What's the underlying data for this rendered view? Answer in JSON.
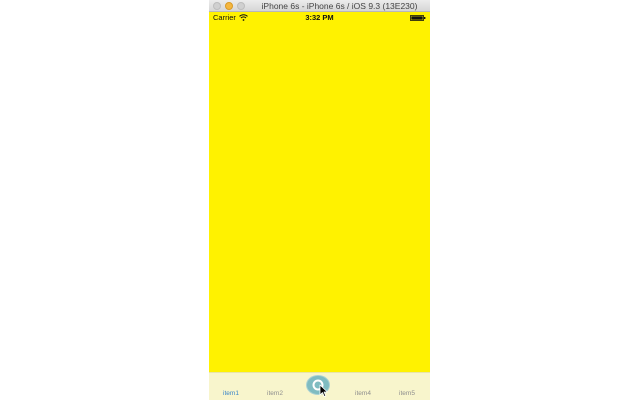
{
  "window": {
    "title": "iPhone 6s - iPhone 6s / iOS 9.3 (13E230)"
  },
  "statusbar": {
    "carrier": "Carrier",
    "time": "3:32 PM"
  },
  "content": {
    "background_color": "#fff200"
  },
  "tabbar": {
    "background_color": "#f8f5cc",
    "selected_color": "#3b86c9",
    "items": [
      {
        "label": "item1",
        "selected": true
      },
      {
        "label": "item2",
        "selected": false
      },
      {
        "label": "",
        "selected": false,
        "icon": "center-circle-icon"
      },
      {
        "label": "item4",
        "selected": false
      },
      {
        "label": "item5",
        "selected": false
      }
    ]
  }
}
